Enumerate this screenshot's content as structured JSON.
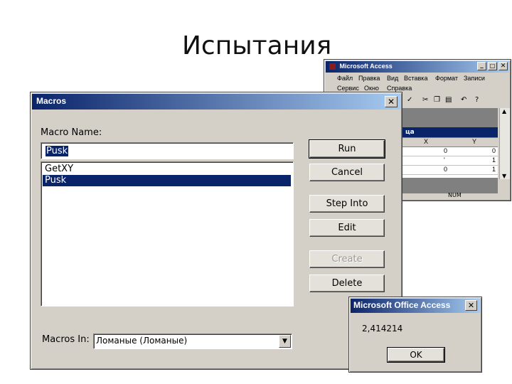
{
  "slide": {
    "title": "Испытания"
  },
  "access_window": {
    "title": "Microsoft Access",
    "menu_row1": [
      "Файл",
      "Правка",
      "Вид",
      "Вставка",
      "Формат",
      "Записи"
    ],
    "menu_row2": [
      "Сервис",
      "Окно",
      "Справка"
    ],
    "table_bar": "ца",
    "columns": [
      "X",
      "Y"
    ],
    "rows": [
      [
        "0",
        "0"
      ],
      [
        "'",
        "1"
      ],
      [
        "0",
        "1"
      ]
    ],
    "status": "NUM"
  },
  "macros_dialog": {
    "title": "Macros",
    "macro_name_label": "Macro Name:",
    "macro_name_value": "Pusk",
    "macros": [
      "GetXY",
      "Pusk"
    ],
    "selected_index": 1,
    "buttons": {
      "run": "Run",
      "cancel": "Cancel",
      "step_into": "Step Into",
      "edit": "Edit",
      "create": "Create",
      "delete": "Delete"
    },
    "macros_in_label": "Macros In:",
    "macros_in_value": "Ломаные (Ломаные)"
  },
  "message_box": {
    "title": "Microsoft Office Access",
    "message": "2,414214",
    "ok_label": "OK"
  },
  "colors": {
    "title_start": "#0a246a",
    "title_end": "#a6caf0",
    "selection": "#0a246a",
    "face": "#d4d0c8"
  }
}
